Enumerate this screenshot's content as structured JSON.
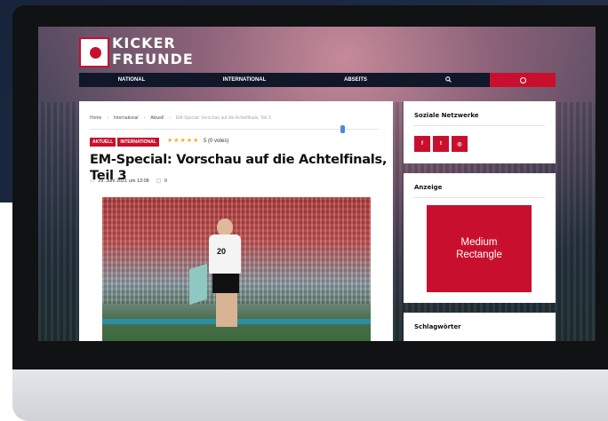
{
  "site": {
    "logo_line1": "KICKER",
    "logo_line2": "FREUNDE"
  },
  "nav": {
    "items": [
      "NATIONAL",
      "INTERNATIONAL",
      "ABSEITS"
    ],
    "search_icon": "search-icon",
    "accent_icon": "dribbble-icon"
  },
  "breadcrumb": {
    "items": [
      "Home",
      "International",
      "Aktuell",
      "EM-Special: Vorschau auf die Achtelfinals, Teil 3"
    ],
    "separator": "›"
  },
  "article": {
    "tags": [
      "AKTUELL",
      "INTERNATIONAL"
    ],
    "stars": "★★★★★",
    "votes": "5 (0 votes)",
    "title": "EM-Special: Vorschau auf die Achtelfinals, Teil 3",
    "date": "29. Juni 2021 um 13:08",
    "comments": "0",
    "image": {
      "jersey_number": "20"
    }
  },
  "sidebar": {
    "social": {
      "title": "Soziale Netzwerke",
      "icons": [
        "facebook-icon",
        "twitter-icon",
        "instagram-icon"
      ],
      "icon_glyphs": [
        "f",
        "t",
        "◎"
      ]
    },
    "ad": {
      "title": "Anzeige",
      "line1": "Medium",
      "line2": "Rectangle"
    },
    "tags": {
      "title": "Schlagwörter"
    }
  },
  "colors": {
    "accent": "#c8102e",
    "nav_bg": "#0f1729",
    "star": "#f2b01e"
  }
}
